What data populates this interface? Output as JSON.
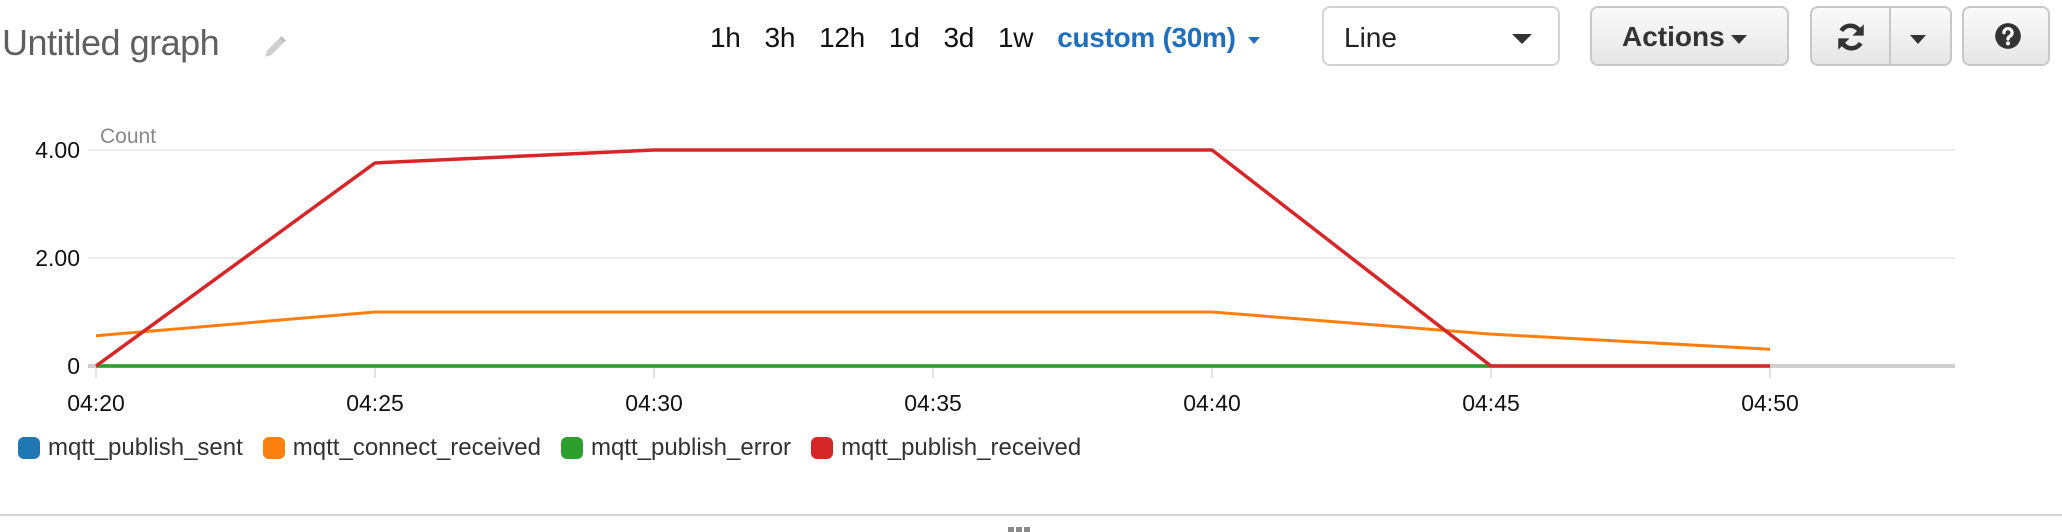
{
  "header": {
    "title": "Untitled graph",
    "edit_icon": "pencil-icon",
    "time_ranges": [
      "1h",
      "3h",
      "12h",
      "1d",
      "3d",
      "1w"
    ],
    "custom_range": "custom (30m)",
    "chart_type_select": {
      "value": "Line"
    },
    "actions_label": "Actions",
    "refresh_icon": "refresh-icon",
    "help_icon": "question-circle-icon"
  },
  "colors": {
    "accent": "#1f6fbf",
    "mqtt_publish_sent": "#1f77b4",
    "mqtt_connect_received": "#ff7f0e",
    "mqtt_publish_error": "#2ca02c",
    "mqtt_publish_received": "#d62728"
  },
  "chart_data": {
    "type": "line",
    "title": "",
    "ylabel": "Count",
    "xlabel": "",
    "x": [
      "04:20",
      "04:25",
      "04:30",
      "04:35",
      "04:40",
      "04:45",
      "04:50"
    ],
    "x_ticks": [
      "04:20",
      "04:25",
      "04:30",
      "04:35",
      "04:40",
      "04:45",
      "04:50"
    ],
    "y_ticks": [
      "0",
      "2.00",
      "4.00"
    ],
    "ylim": [
      0,
      4.2
    ],
    "grid": true,
    "legend_position": "bottom-left",
    "series": [
      {
        "name": "mqtt_publish_sent",
        "color": "#1f77b4",
        "values": [
          null,
          null,
          null,
          null,
          null,
          null,
          null
        ]
      },
      {
        "name": "mqtt_connect_received",
        "color": "#ff7f0e",
        "values": [
          0.56,
          1.0,
          1.0,
          1.0,
          1.0,
          0.59,
          0.31
        ]
      },
      {
        "name": "mqtt_publish_error",
        "color": "#2ca02c",
        "values": [
          0,
          0,
          0,
          0,
          0,
          0,
          null
        ]
      },
      {
        "name": "mqtt_publish_received",
        "color": "#d62728",
        "values": [
          0,
          3.76,
          4.0,
          4.0,
          4.0,
          0,
          0
        ]
      }
    ]
  }
}
